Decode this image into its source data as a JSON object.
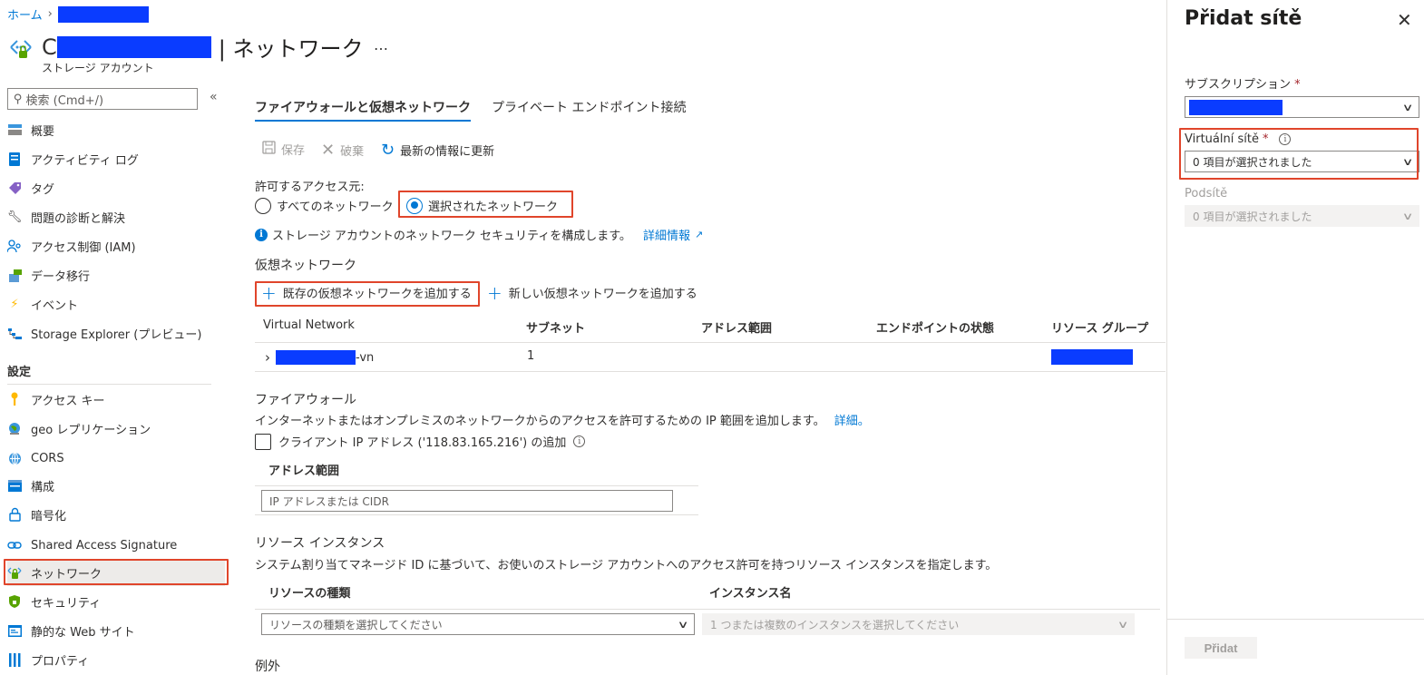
{
  "breadcrumb": {
    "home": "ホーム"
  },
  "header": {
    "title_suffix": "| ネットワーク",
    "title_prefix": "C",
    "subtitle": "ストレージ アカウント",
    "more": "…"
  },
  "sidebar": {
    "search_placeholder": "検索 (Cmd+/)",
    "collapse": "«",
    "items": [
      {
        "label": "概要",
        "icon": "overview-icon"
      },
      {
        "label": "アクティビティ ログ",
        "icon": "activity-log-icon"
      },
      {
        "label": "タグ",
        "icon": "tag-icon"
      },
      {
        "label": "問題の診断と解決",
        "icon": "wrench-icon"
      },
      {
        "label": "アクセス制御 (IAM)",
        "icon": "people-icon"
      },
      {
        "label": "データ移行",
        "icon": "migration-icon"
      },
      {
        "label": "イベント",
        "icon": "lightning-icon"
      },
      {
        "label": "Storage Explorer (プレビュー)",
        "icon": "explorer-icon"
      }
    ],
    "settings_heading": "設定",
    "settings_items": [
      {
        "label": "アクセス キー",
        "icon": "key-icon"
      },
      {
        "label": "geo レプリケーション",
        "icon": "globe-icon"
      },
      {
        "label": "CORS",
        "icon": "cors-icon"
      },
      {
        "label": "構成",
        "icon": "config-icon"
      },
      {
        "label": "暗号化",
        "icon": "lock-icon"
      },
      {
        "label": "Shared Access Signature",
        "icon": "link-icon"
      },
      {
        "label": "ネットワーク",
        "icon": "network-icon"
      },
      {
        "label": "セキュリティ",
        "icon": "shield-icon"
      },
      {
        "label": "静的な Web サイト",
        "icon": "website-icon"
      },
      {
        "label": "プロパティ",
        "icon": "properties-icon"
      }
    ]
  },
  "tabs": {
    "firewall": "ファイアウォールと仮想ネットワーク",
    "private": "プライベート エンドポイント接続"
  },
  "toolbar": {
    "save": "保存",
    "discard": "破棄",
    "refresh": "最新の情報に更新"
  },
  "access": {
    "label": "許可するアクセス元:",
    "all": "すべてのネットワーク",
    "selected": "選択されたネットワーク",
    "info": "ストレージ アカウントのネットワーク セキュリティを構成します。",
    "learn_more": "詳細情報"
  },
  "vnet": {
    "heading": "仮想ネットワーク",
    "add_existing": "既存の仮想ネットワークを追加する",
    "add_new": "新しい仮想ネットワークを追加する",
    "columns": [
      "Virtual Network",
      "サブネット",
      "アドレス範囲",
      "エンドポイントの状態",
      "リソース グループ"
    ],
    "row": {
      "name_suffix": "-vn",
      "subnets": "1"
    }
  },
  "firewall": {
    "heading": "ファイアウォール",
    "desc": "インターネットまたはオンプレミスのネットワークからのアクセスを許可するための IP 範囲を追加します。",
    "desc_link": "詳細。",
    "client_ip": "クライアント IP アドレス ('118.83.165.216') の追加",
    "addr_header": "アドレス範囲",
    "addr_placeholder": "IP アドレスまたは CIDR"
  },
  "resource_instances": {
    "heading": "リソース インスタンス",
    "desc": "システム割り当てマネージド ID に基づいて、お使いのストレージ アカウントへのアクセス許可を持つリソース インスタンスを指定します。",
    "col_type": "リソースの種類",
    "col_name": "インスタンス名",
    "type_placeholder": "リソースの種類を選択してください",
    "name_placeholder": "1 つまたは複数のインスタンスを選択してください"
  },
  "exceptions": {
    "heading": "例外"
  },
  "panel": {
    "title": "Přidat sítě",
    "close": "✕",
    "subscription_label": "サブスクリプション",
    "vnet_label": "Virtuální sítě",
    "vnet_value": "0 項目が選択されました",
    "subnet_label": "Podsítě",
    "subnet_value": "0 項目が選択されました",
    "required_mark": "*",
    "add_button": "Přidat"
  },
  "colors": {
    "accent": "#0078d4",
    "highlight_box": "#e0452b",
    "redaction": "#0a3cff"
  }
}
